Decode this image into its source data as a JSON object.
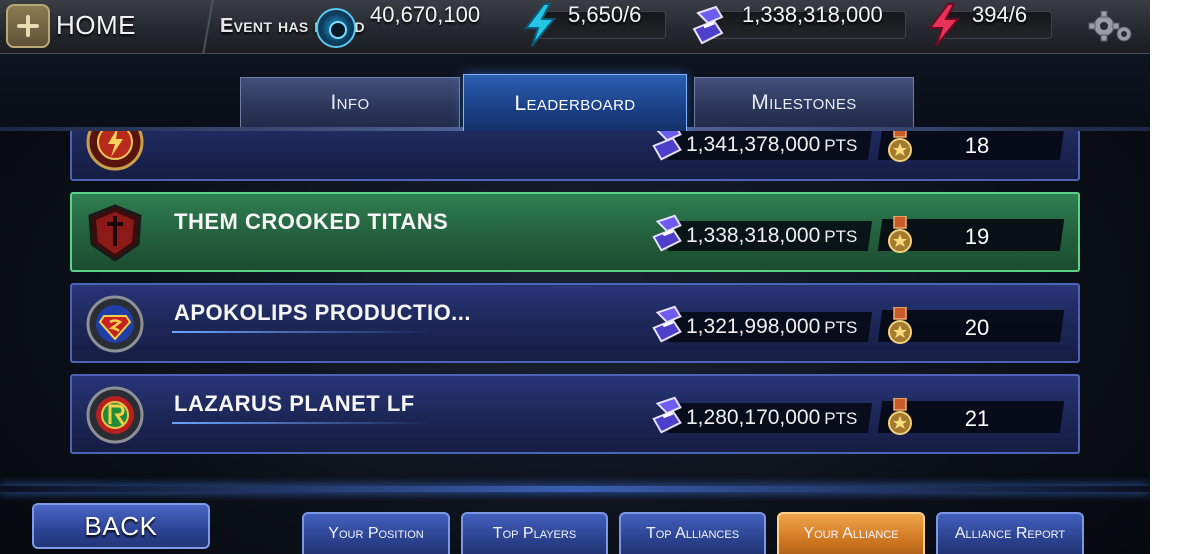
{
  "topbar": {
    "home_label": "HOME",
    "event_status": "Event has ended",
    "credits": "40,670,100",
    "energy": "5,650/6",
    "points": "1,338,318,000",
    "stamina": "394/6"
  },
  "tabs": [
    {
      "label": "Info",
      "active": false
    },
    {
      "label": "Leaderboard",
      "active": true
    },
    {
      "label": "Milestones",
      "active": false
    }
  ],
  "leaderboard": [
    {
      "name": "",
      "points": "1,341,378,000",
      "rank": "18",
      "emblem": "flash-emblem-icon",
      "highlight": false
    },
    {
      "name": "THEM CROOKED TITANS",
      "points": "1,338,318,000",
      "rank": "19",
      "emblem": "sword-emblem-icon",
      "highlight": true
    },
    {
      "name": "APOKOLIPS PRODUCTIO...",
      "points": "1,321,998,000",
      "rank": "20",
      "emblem": "superman-emblem-icon",
      "highlight": false
    },
    {
      "name": "LAZARUS PLANET LF",
      "points": "1,280,170,000",
      "rank": "21",
      "emblem": "robin-emblem-icon",
      "highlight": false
    }
  ],
  "points_unit": "PTS",
  "bottom": {
    "back_label": "BACK",
    "nav": [
      {
        "label": "Your Position",
        "active": false
      },
      {
        "label": "Top Players",
        "active": false
      },
      {
        "label": "Top Alliances",
        "active": false
      },
      {
        "label": "Your Alliance",
        "active": true
      },
      {
        "label": "Alliance Report",
        "active": false
      }
    ]
  },
  "colors": {
    "row_border": "#4d63b7",
    "highlight_row": "#23603d",
    "active_nav": "#cf7822",
    "active_tab": "#1a3f86"
  }
}
